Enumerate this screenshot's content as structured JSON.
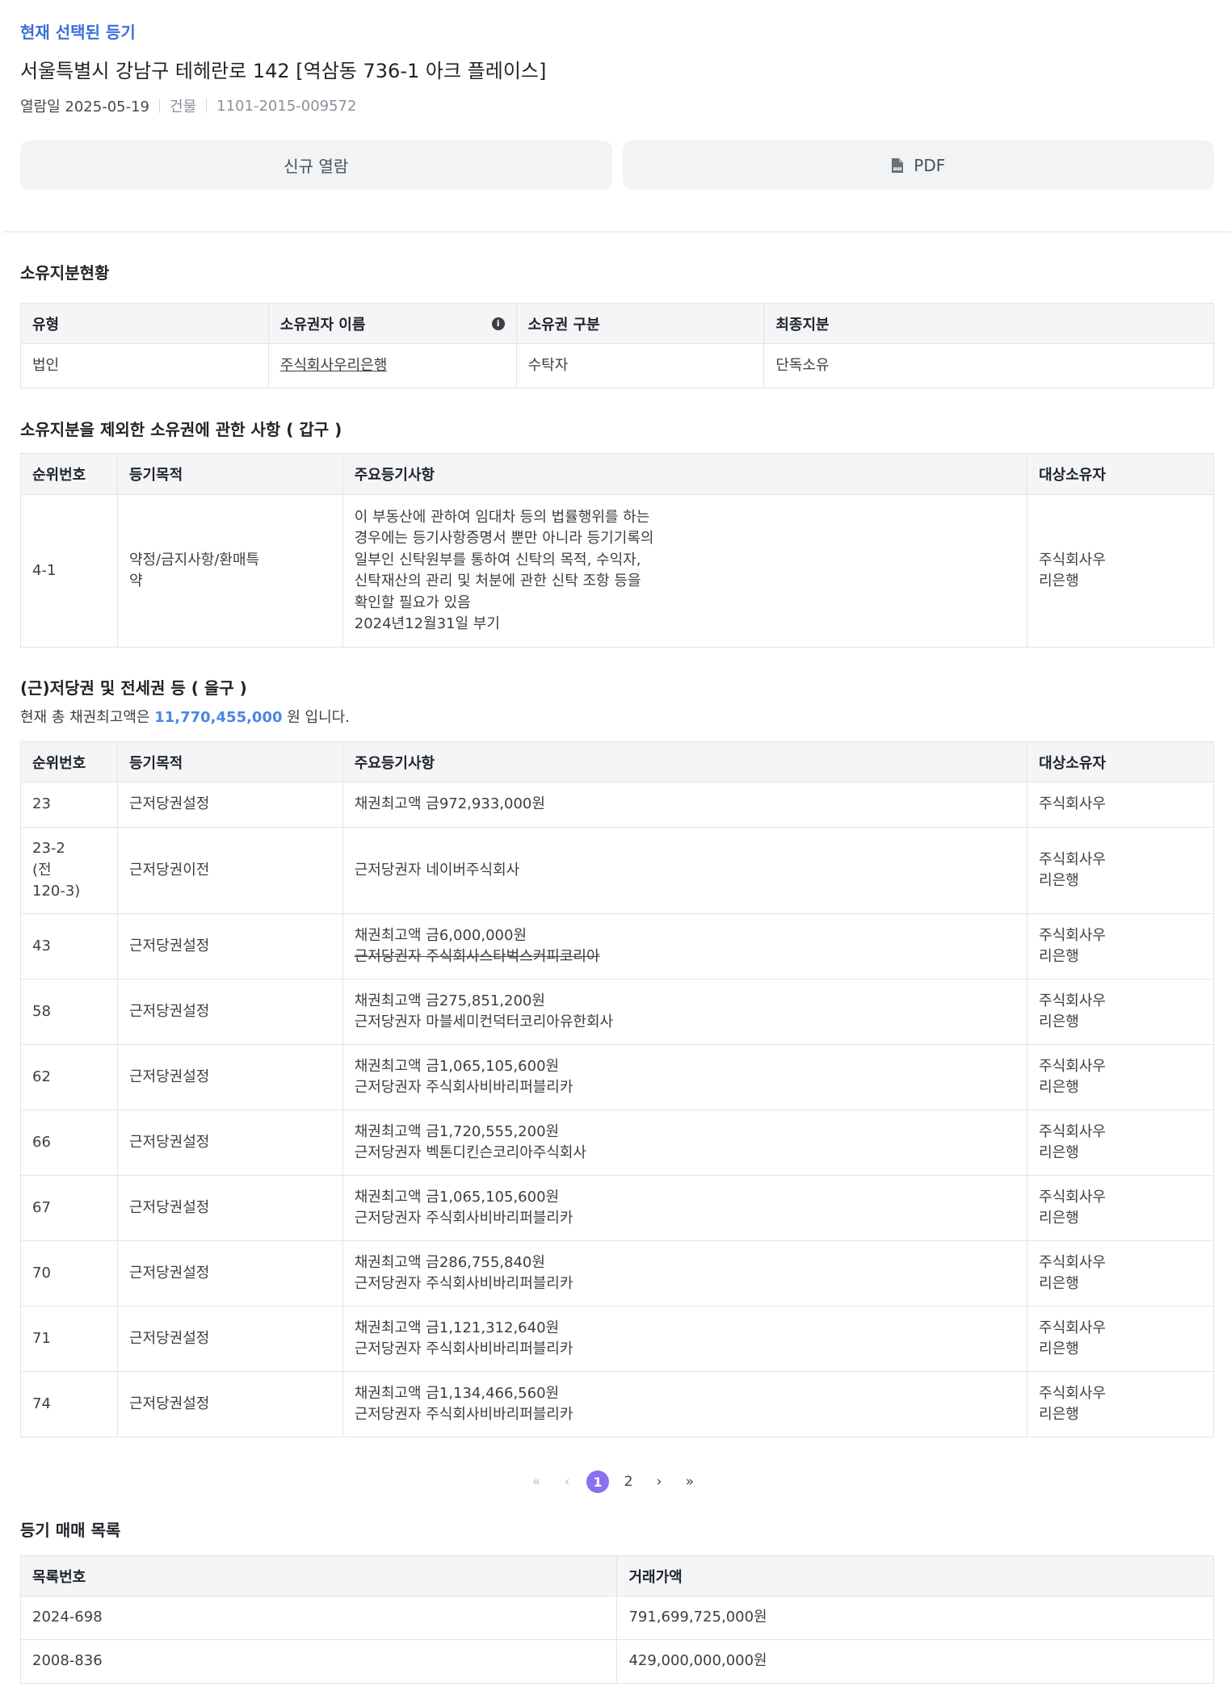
{
  "header": {
    "selected_label": "현재 선택된 등기",
    "address": "서울특별시 강남구 테헤란로 142 [역삼동 736-1 아크 플레이스]",
    "view_date": "열람일 2025-05-19",
    "type": "건물",
    "reg_no": "1101-2015-009572"
  },
  "buttons": {
    "new_view": "신규 열람",
    "pdf": "PDF"
  },
  "ownership": {
    "title": "소유지분현황",
    "headers": [
      "유형",
      "소유권자 이름",
      "소유권 구분",
      "최종지분"
    ],
    "row": [
      "법인",
      "주식회사우리은행",
      "수탁자",
      "단독소유"
    ]
  },
  "gap_section": {
    "title": "소유지분을 제외한 소유권에 관한 사항 ( 갑구 )",
    "headers": [
      "순위번호",
      "등기목적",
      "주요등기사항",
      "대상소유자"
    ],
    "row": {
      "rank": "4-1",
      "purpose": [
        "약정/금지사항/환매특",
        "약"
      ],
      "details": [
        "이 부동산에 관하여 임대차 등의 법률행위를 하는",
        "경우에는 등기사항증명서 뿐만 아니라 등기기록의",
        "일부인 신탁원부를 통하여 신탁의 목적, 수익자,",
        "신탁재산의 관리 및 처분에 관한 신탁 조항 등을",
        "확인할 필요가 있음",
        "2024년12월31일 부기"
      ],
      "owner": [
        "주식회사우",
        "리은행"
      ]
    }
  },
  "eul_section": {
    "title": "(근)저당권 및 전세권 등 ( 을구 )",
    "summary_prefix": "현재 총 채권최고액은",
    "summary_amount": "11,770,455,000",
    "summary_suffix": "원 입니다.",
    "headers": [
      "순위번호",
      "등기목적",
      "주요등기사항",
      "대상소유자"
    ],
    "rows": [
      {
        "rank": [
          "23"
        ],
        "purpose": "근저당권설정",
        "d1": "채권최고액 금972,933,000원",
        "d2": "",
        "o1": "주식회사우",
        "o2": ""
      },
      {
        "rank": [
          "23-2",
          "(전",
          "120-3)"
        ],
        "purpose": "근저당권이전",
        "d1": "근저당권자 네이버주식회사",
        "d2": "",
        "o1": "주식회사우",
        "o2": "리은행"
      },
      {
        "rank": [
          "43"
        ],
        "purpose": "근저당권설정",
        "d1": "채권최고액 금6,000,000원",
        "d2": "근저당권자 주식회사스타벅스커피코리아",
        "o1": "주식회사우",
        "o2": "리은행"
      },
      {
        "rank": [
          "58"
        ],
        "purpose": "근저당권설정",
        "d1": "채권최고액 금275,851,200원",
        "d2": "근저당권자 마블세미컨덕터코리아유한회사",
        "o1": "주식회사우",
        "o2": "리은행"
      },
      {
        "rank": [
          "62"
        ],
        "purpose": "근저당권설정",
        "d1": "채권최고액 금1,065,105,600원",
        "d2": "근저당권자 주식회사비바리퍼블리카",
        "o1": "주식회사우",
        "o2": "리은행"
      },
      {
        "rank": [
          "66"
        ],
        "purpose": "근저당권설정",
        "d1": "채권최고액 금1,720,555,200원",
        "d2": "근저당권자 벡톤디킨슨코리아주식회사",
        "o1": "주식회사우",
        "o2": "리은행"
      },
      {
        "rank": [
          "67"
        ],
        "purpose": "근저당권설정",
        "d1": "채권최고액 금1,065,105,600원",
        "d2": "근저당권자 주식회사비바리퍼블리카",
        "o1": "주식회사우",
        "o2": "리은행"
      },
      {
        "rank": [
          "70"
        ],
        "purpose": "근저당권설정",
        "d1": "채권최고액 금286,755,840원",
        "d2": "근저당권자 주식회사비바리퍼블리카",
        "o1": "주식회사우",
        "o2": "리은행"
      },
      {
        "rank": [
          "71"
        ],
        "purpose": "근저당권설정",
        "d1": "채권최고액 금1,121,312,640원",
        "d2": "근저당권자 주식회사비바리퍼블리카",
        "o1": "주식회사우",
        "o2": "리은행"
      },
      {
        "rank": [
          "74"
        ],
        "purpose": "근저당권설정",
        "d1": "채권최고액 금1,134,466,560원",
        "d2": "근저당권자 주식회사비바리퍼블리카",
        "o1": "주식회사우",
        "o2": "리은행"
      }
    ]
  },
  "pagination": {
    "first": "«",
    "prev": "‹",
    "pages": [
      "1",
      "2"
    ],
    "current": "1",
    "next": "›",
    "last": "»"
  },
  "trade": {
    "title": "등기 매매 목록",
    "headers": [
      "목록번호",
      "거래가액"
    ],
    "rows": [
      [
        "2024-698",
        "791,699,725,000원"
      ],
      [
        "2008-836",
        "429,000,000,000원"
      ]
    ]
  }
}
